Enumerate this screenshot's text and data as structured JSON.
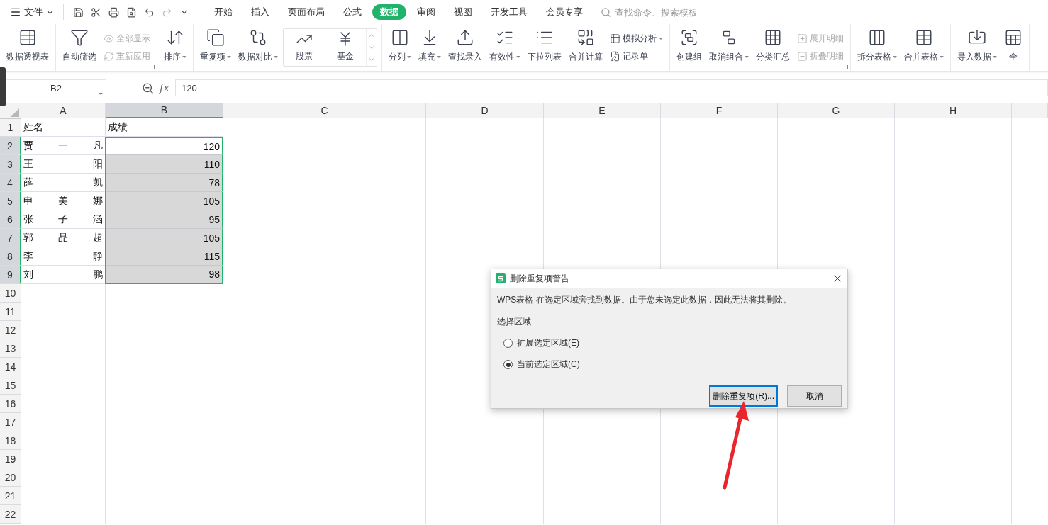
{
  "menu": {
    "file": "文件",
    "tabs": [
      {
        "label": "开始",
        "selected": false
      },
      {
        "label": "插入",
        "selected": false
      },
      {
        "label": "页面布局",
        "selected": false
      },
      {
        "label": "公式",
        "selected": false
      },
      {
        "label": "数据",
        "selected": true
      },
      {
        "label": "审阅",
        "selected": false
      },
      {
        "label": "视图",
        "selected": false
      },
      {
        "label": "开发工具",
        "selected": false
      },
      {
        "label": "会员专享",
        "selected": false
      }
    ],
    "search": {
      "placeholder": "查找命令、搜索模板"
    }
  },
  "ribbon": {
    "groups": [
      {
        "launcher": false,
        "items": [
          {
            "kind": "large",
            "label": "数据透视表",
            "dropdown": false
          }
        ]
      },
      {
        "launcher": true,
        "items": [
          {
            "kind": "large",
            "label": "自动筛选",
            "dropdown": false
          },
          {
            "kind": "stack",
            "entries": [
              {
                "label": "全部显示",
                "disabled": true,
                "dropdown": false
              },
              {
                "label": "重新应用",
                "disabled": true,
                "dropdown": false
              }
            ]
          }
        ]
      },
      {
        "launcher": false,
        "items": [
          {
            "kind": "large",
            "label": "排序",
            "dropdown": true
          }
        ]
      },
      {
        "launcher": false,
        "items": [
          {
            "kind": "large",
            "label": "重复项",
            "dropdown": true
          },
          {
            "kind": "large",
            "label": "数据对比",
            "dropdown": true
          },
          {
            "kind": "gallery",
            "entries": [
              {
                "label": "股票"
              },
              {
                "label": "基金"
              }
            ]
          }
        ]
      },
      {
        "launcher": false,
        "items": [
          {
            "kind": "large",
            "label": "分列",
            "dropdown": true
          },
          {
            "kind": "large",
            "label": "填充",
            "dropdown": true
          },
          {
            "kind": "large",
            "label": "查找录入",
            "dropdown": false
          },
          {
            "kind": "large",
            "label": "有效性",
            "dropdown": true
          },
          {
            "kind": "large",
            "label": "下拉列表",
            "dropdown": false
          },
          {
            "kind": "large",
            "label": "合并计算",
            "dropdown": false
          },
          {
            "kind": "stack",
            "entries": [
              {
                "label": "模拟分析",
                "disabled": false,
                "dropdown": true
              },
              {
                "label": "记录单",
                "disabled": false,
                "dropdown": false
              }
            ]
          }
        ]
      },
      {
        "launcher": true,
        "items": [
          {
            "kind": "large",
            "label": "创建组",
            "dropdown": false
          },
          {
            "kind": "large",
            "label": "取消组合",
            "dropdown": true
          },
          {
            "kind": "large",
            "label": "分类汇总",
            "dropdown": false
          },
          {
            "kind": "stack",
            "entries": [
              {
                "label": "展开明细",
                "disabled": true,
                "dropdown": false
              },
              {
                "label": "折叠明细",
                "disabled": true,
                "dropdown": false
              }
            ]
          }
        ]
      },
      {
        "launcher": false,
        "items": [
          {
            "kind": "large",
            "label": "拆分表格",
            "dropdown": true
          },
          {
            "kind": "large",
            "label": "合并表格",
            "dropdown": true
          }
        ]
      },
      {
        "launcher": false,
        "items": [
          {
            "kind": "large",
            "label": "导入数据",
            "dropdown": true
          },
          {
            "kind": "large",
            "label": "全",
            "dropdown": false
          }
        ]
      }
    ]
  },
  "formula_bar": {
    "cell": "B2",
    "fx": "fx",
    "value": "120"
  },
  "sheet": {
    "columns": [
      {
        "label": "A",
        "selected": false
      },
      {
        "label": "B",
        "selected": true
      },
      {
        "label": "C",
        "selected": false
      },
      {
        "label": "D",
        "selected": false
      },
      {
        "label": "E",
        "selected": false
      },
      {
        "label": "F",
        "selected": false
      },
      {
        "label": "G",
        "selected": false
      },
      {
        "label": "H",
        "selected": false
      }
    ],
    "rows": [
      {
        "header": "1",
        "selected": false,
        "cells": [
          {
            "text": "姓名",
            "kind": "heading",
            "selected": false
          },
          {
            "text": "成绩",
            "kind": "heading",
            "selected": false
          }
        ]
      },
      {
        "header": "2",
        "selected": true,
        "cells": [
          {
            "text": "贾一凡",
            "kind": "name",
            "selected": false
          },
          {
            "text": "120",
            "kind": "number",
            "selected": true
          }
        ]
      },
      {
        "header": "3",
        "selected": true,
        "cells": [
          {
            "text": "王阳",
            "kind": "name",
            "selected": false
          },
          {
            "text": "110",
            "kind": "number",
            "selected": true
          }
        ]
      },
      {
        "header": "4",
        "selected": true,
        "cells": [
          {
            "text": "薛凯",
            "kind": "name",
            "selected": false
          },
          {
            "text": "78",
            "kind": "number",
            "selected": true
          }
        ]
      },
      {
        "header": "5",
        "selected": true,
        "cells": [
          {
            "text": "申美娜",
            "kind": "name",
            "selected": false
          },
          {
            "text": "105",
            "kind": "number",
            "selected": true
          }
        ]
      },
      {
        "header": "6",
        "selected": true,
        "cells": [
          {
            "text": "张子涵",
            "kind": "name",
            "selected": false
          },
          {
            "text": "95",
            "kind": "number",
            "selected": true
          }
        ]
      },
      {
        "header": "7",
        "selected": true,
        "cells": [
          {
            "text": "郭品超",
            "kind": "name",
            "selected": false
          },
          {
            "text": "105",
            "kind": "number",
            "selected": true
          }
        ]
      },
      {
        "header": "8",
        "selected": true,
        "cells": [
          {
            "text": "李静",
            "kind": "name",
            "selected": false
          },
          {
            "text": "115",
            "kind": "number",
            "selected": true
          }
        ]
      },
      {
        "header": "9",
        "selected": true,
        "cells": [
          {
            "text": "刘鹏",
            "kind": "name",
            "selected": false
          },
          {
            "text": "98",
            "kind": "number",
            "selected": true
          }
        ]
      },
      {
        "header": "10",
        "selected": false,
        "cells": []
      },
      {
        "header": "11",
        "selected": false,
        "cells": []
      },
      {
        "header": "12",
        "selected": false,
        "cells": []
      },
      {
        "header": "13",
        "selected": false,
        "cells": []
      },
      {
        "header": "14",
        "selected": false,
        "cells": []
      },
      {
        "header": "15",
        "selected": false,
        "cells": []
      },
      {
        "header": "16",
        "selected": false,
        "cells": []
      },
      {
        "header": "17",
        "selected": false,
        "cells": []
      },
      {
        "header": "18",
        "selected": false,
        "cells": []
      },
      {
        "header": "19",
        "selected": false,
        "cells": []
      },
      {
        "header": "20",
        "selected": false,
        "cells": []
      },
      {
        "header": "21",
        "selected": false,
        "cells": []
      },
      {
        "header": "22",
        "selected": false,
        "cells": []
      }
    ]
  },
  "dialog": {
    "title": "删除重复项警告",
    "message": "WPS表格 在选定区域旁找到数据。由于您未选定此数据，因此无法将其删除。",
    "group_label": "选择区域",
    "options": [
      {
        "label": "扩展选定区域(E)",
        "selected": false
      },
      {
        "label": "当前选定区域(C)",
        "selected": true
      }
    ],
    "buttons": [
      {
        "label": "删除重复项(R)...",
        "default": true
      },
      {
        "label": "取消",
        "default": false
      }
    ]
  }
}
